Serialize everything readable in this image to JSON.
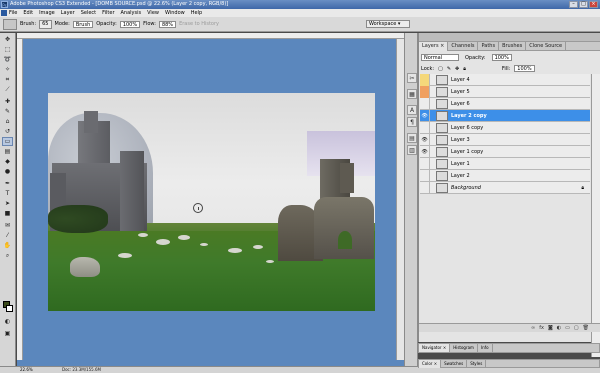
{
  "window": {
    "title": "Adobe Photoshop CS3 Extended - [DOMB SOURCE.psd @ 22.6% (Layer 2 copy, RGB/8)]",
    "app_logo": "Ps"
  },
  "menu": [
    "File",
    "Edit",
    "Image",
    "Layer",
    "Select",
    "Filter",
    "Analysis",
    "View",
    "Window",
    "Help"
  ],
  "options": {
    "brush_label": "Brush:",
    "brush_size": "65",
    "mode_label": "Mode:",
    "mode_value": "Brush",
    "opacity_label": "Opacity:",
    "opacity_value": "100%",
    "flow_label": "Flow:",
    "flow_value": "88%",
    "erase_history": "Erase to History",
    "workspace": "Workspace ▾"
  },
  "status": {
    "zoom": "22.6%",
    "doc": "Doc: 23.3M/155.6M"
  },
  "layers_panel": {
    "tabs": [
      "Layers ×",
      "Channels",
      "Paths",
      "Brushes",
      "Clone Source"
    ],
    "blend_mode": "Normal",
    "opacity_label": "Opacity:",
    "opacity_value": "100%",
    "lock_label": "Lock:",
    "fill_label": "Fill:",
    "fill_value": "100%",
    "layers": [
      {
        "name": "Layer 4",
        "visible": false,
        "selected": false,
        "color": "#f5d87a"
      },
      {
        "name": "Layer 5",
        "visible": false,
        "selected": false,
        "color": "#f0a060"
      },
      {
        "name": "Layer 6",
        "visible": false,
        "selected": false,
        "color": ""
      },
      {
        "name": "Layer 2 copy",
        "visible": true,
        "selected": true,
        "color": ""
      },
      {
        "name": "Layer 6 copy",
        "visible": false,
        "selected": false,
        "color": ""
      },
      {
        "name": "Layer 3",
        "visible": true,
        "selected": false,
        "color": ""
      },
      {
        "name": "Layer 1 copy",
        "visible": true,
        "selected": false,
        "color": ""
      },
      {
        "name": "Layer 1",
        "visible": false,
        "selected": false,
        "color": ""
      },
      {
        "name": "Layer 2",
        "visible": false,
        "selected": false,
        "color": ""
      },
      {
        "name": "Background",
        "visible": false,
        "selected": false,
        "color": "",
        "locked": true
      }
    ]
  },
  "nav_panel": {
    "tabs": [
      "Navigator ×",
      "Histogram",
      "Info"
    ]
  },
  "color_panel": {
    "tabs": [
      "Color ×",
      "Swatches",
      "Styles"
    ]
  }
}
